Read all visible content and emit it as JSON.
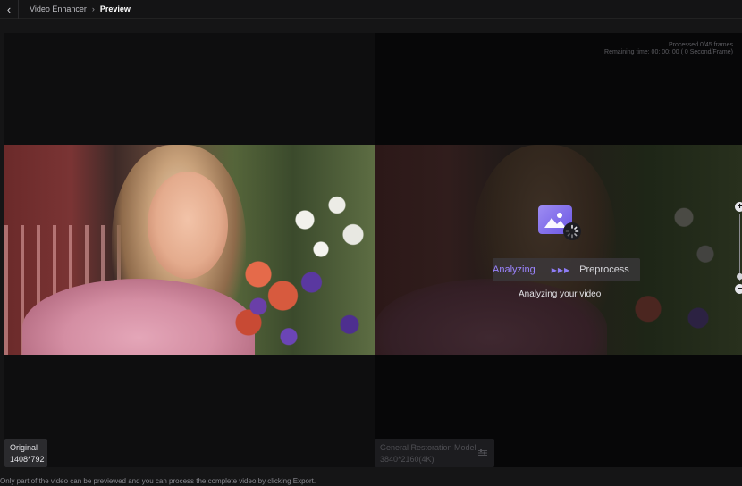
{
  "header": {
    "back_icon": "chevron-left-icon",
    "breadcrumb": [
      "Video Enhancer",
      "Preview"
    ],
    "separator_icon": "chevron-right-icon"
  },
  "preview": {
    "processing": {
      "frames": "Processed 0/45 frames",
      "remaining": "Remaining time: 00: 00: 00 ( 0 Second/Frame)"
    },
    "status": {
      "active_step": "Analyzing",
      "next_step": "Preprocess",
      "message": "Analyzing your video",
      "accent_color": "#8e7cf5"
    },
    "original": {
      "label": "Original",
      "resolution": "1408*792"
    },
    "enhanced": {
      "model": "General Restoration Model",
      "resolution": "3840*2160(4K)"
    },
    "zoom": {
      "plus_icon": "plus-icon",
      "minus_icon": "minus-icon"
    }
  },
  "footer": {
    "note": "Only part of the video can be previewed and you can process the complete video by clicking Export."
  }
}
